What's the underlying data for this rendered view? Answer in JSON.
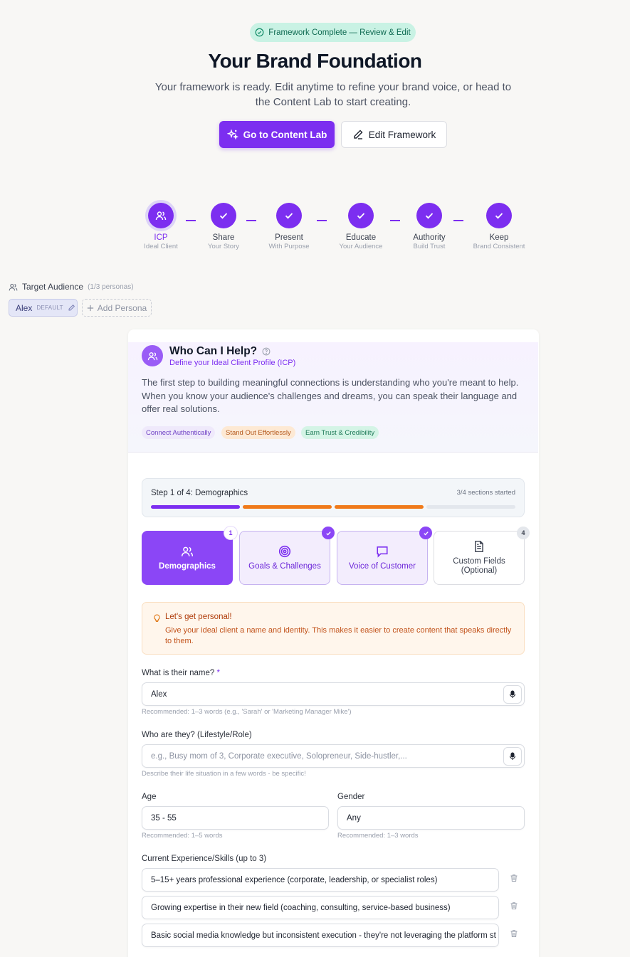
{
  "header": {
    "badge": "Framework Complete — Review & Edit",
    "title": "Your Brand Foundation",
    "subtitle": "Your framework is ready. Edit anytime to refine your brand voice, or head to the Content Lab to start creating.",
    "primary_button": "Go to Content Lab",
    "secondary_button": "Edit Framework"
  },
  "stepper": [
    {
      "label": "ICP",
      "sub": "Ideal Client",
      "state": "active"
    },
    {
      "label": "Share",
      "sub": "Your Story",
      "state": "done"
    },
    {
      "label": "Present",
      "sub": "With Purpose",
      "state": "done"
    },
    {
      "label": "Educate",
      "sub": "Your Audience",
      "state": "done"
    },
    {
      "label": "Authority",
      "sub": "Build Trust",
      "state": "done"
    },
    {
      "label": "Keep",
      "sub": "Brand Consistent",
      "state": "done"
    }
  ],
  "audience": {
    "label": "Target Audience",
    "count": "(1/3 personas)",
    "persona_name": "Alex",
    "persona_badge": "DEFAULT",
    "add_label": "Add Persona"
  },
  "icp": {
    "title": "Who Can I Help?",
    "subtitle": "Define your Ideal Client Profile (ICP)",
    "description": "The first step to building meaningful connections is understanding who you're meant to help. When you know your audience's challenges and dreams, you can speak their language and offer real solutions.",
    "tags": [
      "Connect Authentically",
      "Stand Out Effortlessly",
      "Earn Trust & Credibility"
    ]
  },
  "progress": {
    "title": "Step 1 of 4: Demographics",
    "count": "3/4 sections started",
    "segments": [
      {
        "state": "active",
        "color": "#7c2ef0"
      },
      {
        "state": "started",
        "color": "#f07a1a"
      },
      {
        "state": "started",
        "color": "#f07a1a"
      },
      {
        "state": "empty",
        "color": "#e3e7ed"
      }
    ]
  },
  "tabs": [
    {
      "label": "Demographics",
      "badge": "1"
    },
    {
      "label": "Goals & Challenges",
      "badge": "check"
    },
    {
      "label": "Voice of Customer",
      "badge": "check"
    },
    {
      "label": "Custom Fields (Optional)",
      "badge": "4"
    }
  ],
  "tip": {
    "title": "Let's get personal!",
    "text": "Give your ideal client a name and identity. This makes it easier to create content that speaks directly to them."
  },
  "form": {
    "name_label": "What is their name?",
    "name_required": "*",
    "name_value": "Alex",
    "name_hint": "Recommended: 1–3 words (e.g., 'Sarah' or 'Marketing Manager Mike')",
    "who_label": "Who are they? (Lifestyle/Role)",
    "who_placeholder": "e.g., Busy mom of 3, Corporate executive, Solopreneur, Side-hustler,...",
    "who_hint": "Describe their life situation in a few words - be specific!",
    "age_label": "Age",
    "age_value": "35 - 55",
    "age_hint": "Recommended: 1–5 words",
    "gender_label": "Gender",
    "gender_value": "Any",
    "gender_hint": "Recommended: 1–3 words",
    "skills_label": "Current Experience/Skills (up to 3)",
    "skills": [
      "5–15+ years professional experience (corporate, leadership, or specialist roles)",
      "Growing expertise in their new field (coaching, consulting, service-based business)",
      "Basic social media knowledge but inconsistent execution - they're not leveraging the  platform st"
    ]
  }
}
